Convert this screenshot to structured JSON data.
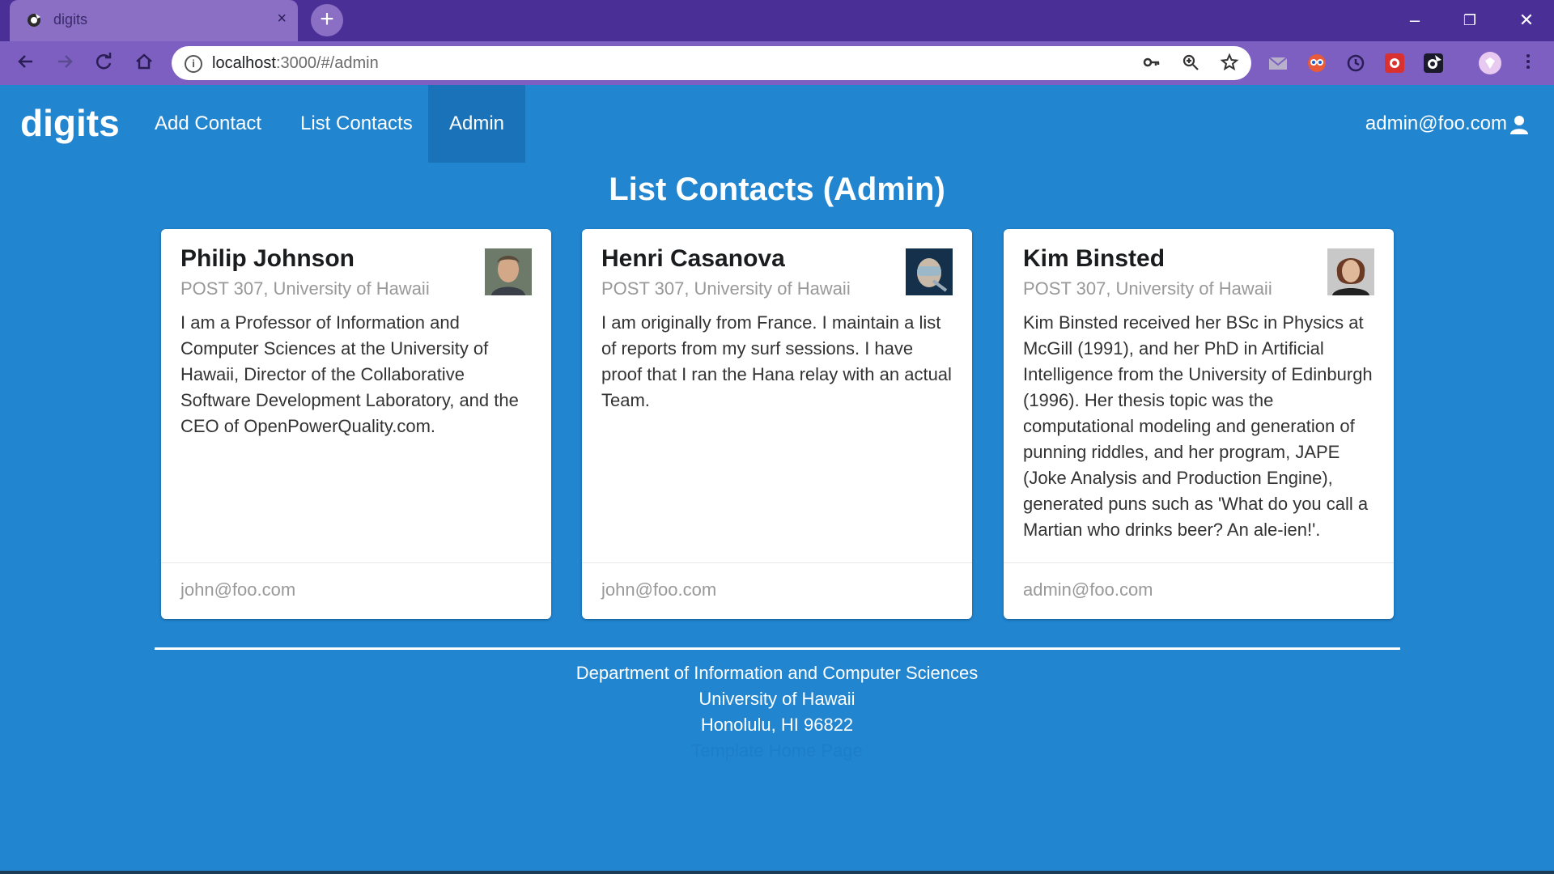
{
  "browser": {
    "tab_title": "digits",
    "tab_close": "×",
    "new_tab": "+",
    "url_host": "localhost",
    "url_rest": ":3000/#/admin",
    "window_controls": {
      "minimize": "–",
      "restore": "❐",
      "close": "✕"
    }
  },
  "nav": {
    "brand": "digits",
    "items": [
      {
        "label": "Add Contact"
      },
      {
        "label": "List Contacts"
      },
      {
        "label": "Admin"
      }
    ],
    "user": "admin@foo.com"
  },
  "page": {
    "title": "List Contacts (Admin)"
  },
  "contacts": [
    {
      "name": "Philip Johnson",
      "address": "POST 307, University of Hawaii",
      "description": "I am a Professor of Information and Computer Sciences at the University of Hawaii, Director of the Collaborative Software Development Laboratory, and the CEO of OpenPowerQuality.com.",
      "owner": "john@foo.com"
    },
    {
      "name": "Henri Casanova",
      "address": "POST 307, University of Hawaii",
      "description": "I am originally from France. I maintain a list of reports from my surf sessions. I have proof that I ran the Hana relay with an actual Team.",
      "owner": "john@foo.com"
    },
    {
      "name": "Kim Binsted",
      "address": "POST 307, University of Hawaii",
      "description": "Kim Binsted received her BSc in Physics at McGill (1991), and her PhD in Artificial Intelligence from the University of Edinburgh (1996). Her thesis topic was the computational modeling and generation of punning riddles, and her program, JAPE (Joke Analysis and Production Engine), generated puns such as 'What do you call a Martian who drinks beer? An ale-ien!'.",
      "owner": "admin@foo.com"
    }
  ],
  "footer": {
    "line1": "Department of Information and Computer Sciences",
    "line2": "University of Hawaii",
    "line3": "Honolulu, HI 96822",
    "link": "Template Home Page"
  },
  "colors": {
    "page_bg": "#2185d0",
    "active_nav": "#1a72b8",
    "browser_frame": "#4a2f96"
  }
}
